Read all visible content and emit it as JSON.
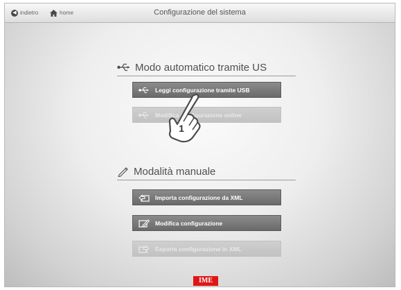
{
  "header": {
    "back_label": "indietro",
    "home_label": "home",
    "title": "Configurazione del sistema"
  },
  "auto_section": {
    "title": "Modo automatico tramite US",
    "icon": "usb-icon",
    "buttons": [
      {
        "label": "Leggi configurazione tramite USB",
        "icon": "usb-icon",
        "enabled": true
      },
      {
        "label": "Modifica configurazione online",
        "icon": "usb-icon",
        "enabled": false
      }
    ]
  },
  "manual_section": {
    "title": "Modalità manuale",
    "icon": "pencil-icon",
    "buttons": [
      {
        "label": "Importa configurazione da XML",
        "icon": "import-icon",
        "enabled": true
      },
      {
        "label": "Modifica configurazione",
        "icon": "edit-icon",
        "enabled": true
      },
      {
        "label": "Esporta configurazione in XML",
        "icon": "export-icon",
        "enabled": false
      }
    ]
  },
  "callout": {
    "step": "1",
    "icon": "pointing-hand-icon"
  },
  "footer": {
    "logo_text": "IME",
    "logo_color": "#e01616"
  },
  "colors": {
    "button_dark": "#7a7a7a",
    "button_disabled": "#c8c8c8"
  }
}
